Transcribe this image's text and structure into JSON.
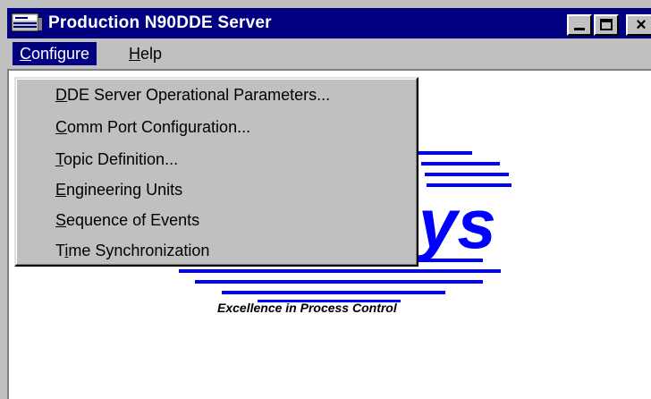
{
  "window": {
    "title": "Production N90DDE Server",
    "icons": {
      "app": "app-icon",
      "minimize": "minimize-icon",
      "maximize": "maximize-icon",
      "close": "close-icon"
    },
    "close_glyph": "×"
  },
  "menubar": {
    "configure": {
      "accel": "C",
      "rest": "onfigure"
    },
    "help": {
      "accel": "H",
      "rest": "elp"
    }
  },
  "dropdown": {
    "items": [
      {
        "pre": "",
        "accel": "D",
        "post": "DE Server Operational Parameters..."
      },
      {
        "pre": "",
        "accel": "C",
        "post": "omm Port Configuration..."
      },
      {
        "pre": "",
        "accel": "T",
        "post": "opic Definition..."
      },
      {
        "pre": "",
        "accel": "E",
        "post": "ngineering Units"
      },
      {
        "pre": "",
        "accel": "S",
        "post": "equence of Events"
      },
      {
        "pre": "T",
        "accel": "i",
        "post": "me Synchronization"
      }
    ]
  },
  "logo": {
    "visible_text": "ys",
    "tagline": "Excellence in Process Control",
    "color": "#0000ff"
  },
  "colors": {
    "titlebar": "#000080",
    "face": "#c0c0c0",
    "client": "#ffffff"
  }
}
